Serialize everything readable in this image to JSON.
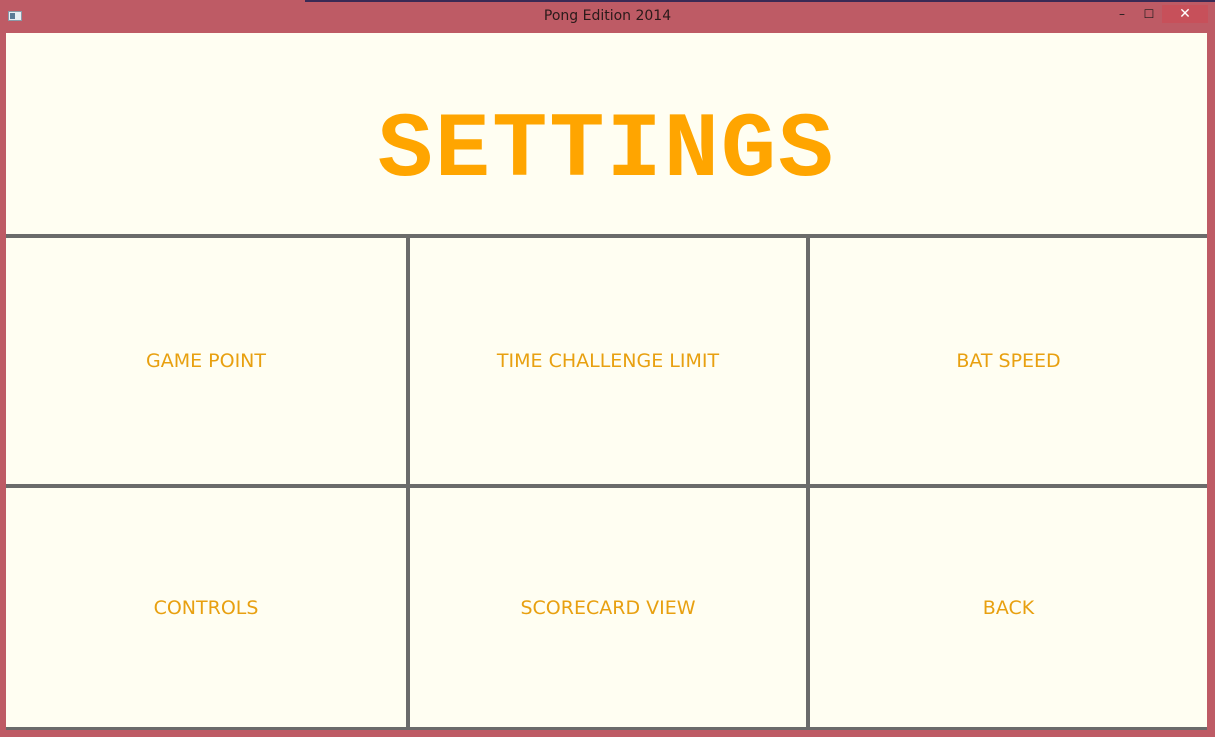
{
  "window": {
    "title": "Pong Edition 2014",
    "minimize_glyph": "–",
    "maximize_glyph": "☐",
    "close_glyph": "✕"
  },
  "header": {
    "title": "SETTINGS"
  },
  "menu": {
    "items": [
      {
        "label": "GAME POINT"
      },
      {
        "label": "TIME CHALLENGE LIMIT"
      },
      {
        "label": "BAT SPEED"
      },
      {
        "label": "CONTROLS"
      },
      {
        "label": "SCORECARD VIEW"
      },
      {
        "label": "BACK"
      }
    ]
  },
  "colors": {
    "title_color": "#ffa500",
    "label_color": "#e8a010",
    "background": "#fffef2",
    "grid_lines": "#6b6b6b",
    "window_frame": "#be5b65"
  }
}
